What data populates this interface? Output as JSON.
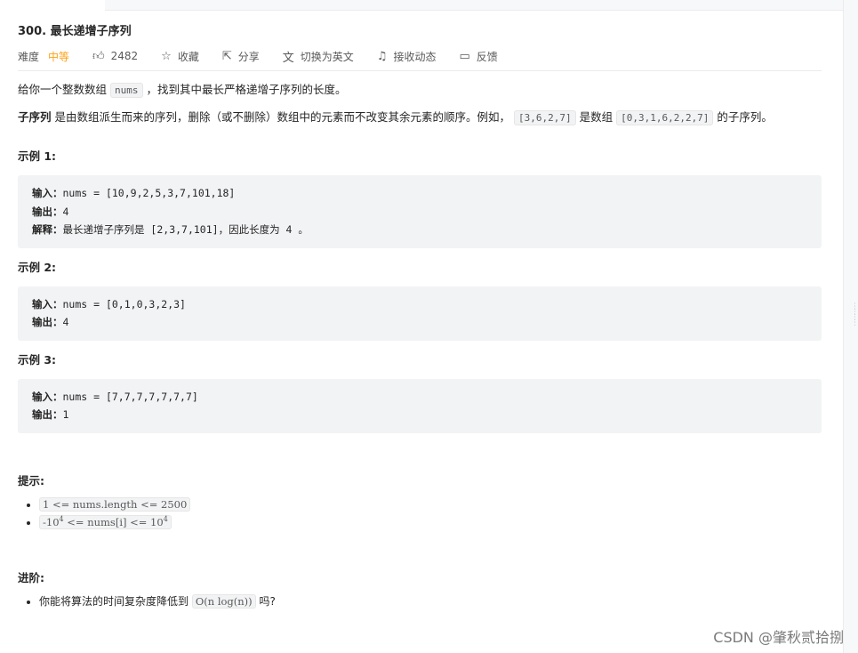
{
  "problem": {
    "title": "300. 最长递增子序列",
    "difficulty_label": "难度",
    "difficulty_value": "中等",
    "likes": "2482",
    "actions": {
      "collect": "收藏",
      "share": "分享",
      "switch_lang": "切换为英文",
      "follow": "接收动态",
      "feedback": "反馈"
    }
  },
  "description": {
    "p1_pre": "给你一个整数数组",
    "p1_code": "nums",
    "p1_post": "，找到其中最长严格递增子序列的长度。",
    "p2_bold": "子序列",
    "p2_text": "是由数组派生而来的序列，删除（或不删除）数组中的元素而不改变其余元素的顺序。例如，",
    "p2_code1": "[3,6,2,7]",
    "p2_mid": "是数组",
    "p2_code2": "[0,3,1,6,2,2,7]",
    "p2_end": "的子序列。"
  },
  "examples": [
    {
      "heading": "示例 1:",
      "input_key": "输入：",
      "input_val": "nums = [10,9,2,5,3,7,101,18]",
      "output_key": "输出：",
      "output_val": "4",
      "explain_key": "解释：",
      "explain_val": "最长递增子序列是 [2,3,7,101]，因此长度为 4 。"
    },
    {
      "heading": "示例 2:",
      "input_key": "输入：",
      "input_val": "nums = [0,1,0,3,2,3]",
      "output_key": "输出：",
      "output_val": "4"
    },
    {
      "heading": "示例 3:",
      "input_key": "输入：",
      "input_val": "nums = [7,7,7,7,7,7,7]",
      "output_key": "输出：",
      "output_val": "1"
    }
  ],
  "hints": {
    "heading": "提示:",
    "item1": "1 <= nums.length <= 2500",
    "item2_pre": "-10",
    "item2_sup1": "4",
    "item2_mid": " <= nums[i] <= 10",
    "item2_sup2": "4"
  },
  "advanced": {
    "heading": "进阶:",
    "pre": "你能将算法的时间复杂度降低到",
    "code": "O(n log(n))",
    "post": "吗?"
  },
  "watermark": "CSDN @肇秋贰拾捌"
}
